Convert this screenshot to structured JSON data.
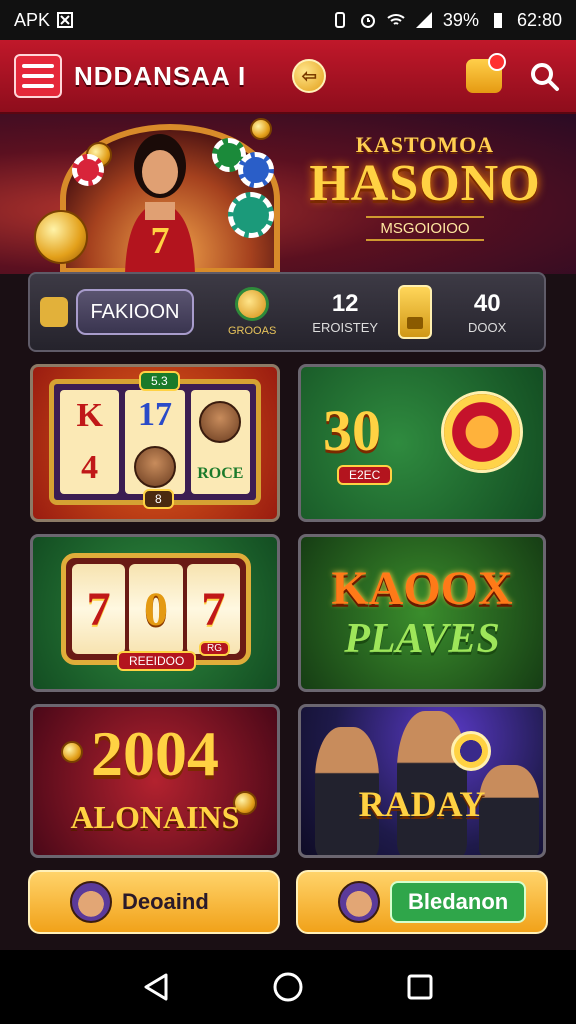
{
  "status_bar": {
    "left_label": "APK",
    "battery_percent": "39%",
    "time": "62:80"
  },
  "header": {
    "title": "NDDANSAA I",
    "coin_symbol": "⇦"
  },
  "hero": {
    "kicker": "KASTOMOA",
    "title": "HASONO",
    "subtitle": "MSGOIOIOO",
    "figure_badge": "7"
  },
  "info_bar": {
    "name_button": "FAKIOON",
    "badge_label": "GROOAS",
    "stat1_value": "12",
    "stat1_label": "EROISTEY",
    "stat2_value": "40",
    "stat2_label": "DOOX"
  },
  "tiles": {
    "tile1": {
      "top_tag": "5.3",
      "symbols": [
        "K",
        "4",
        "17",
        "",
        "",
        "ROCE"
      ],
      "bottom_tag": "8"
    },
    "tile2": {
      "big_number": "30",
      "tag": "E2EC"
    },
    "tile3": {
      "reels": [
        "7",
        "0",
        "7"
      ],
      "tag_left": "REEIDOO",
      "tag_right": "RG"
    },
    "tile4": {
      "line1": "KAOOX",
      "line2": "PLAVES"
    },
    "tile5": {
      "line1": "2004",
      "line2": "ALONAINS"
    },
    "tile6": {
      "line1": "RADAY"
    }
  },
  "cta": {
    "left_label": "Deoaind",
    "right_label": "Bledanon"
  },
  "colors": {
    "header_red": "#c0182a",
    "gold": "#ffd243",
    "green": "#2fa64a"
  },
  "icons": {
    "menu": "hamburger-icon",
    "coin": "coin-icon",
    "bag": "shopping-bag-icon",
    "search": "search-icon",
    "back": "back-icon",
    "home": "home-icon",
    "recents": "recents-icon"
  }
}
